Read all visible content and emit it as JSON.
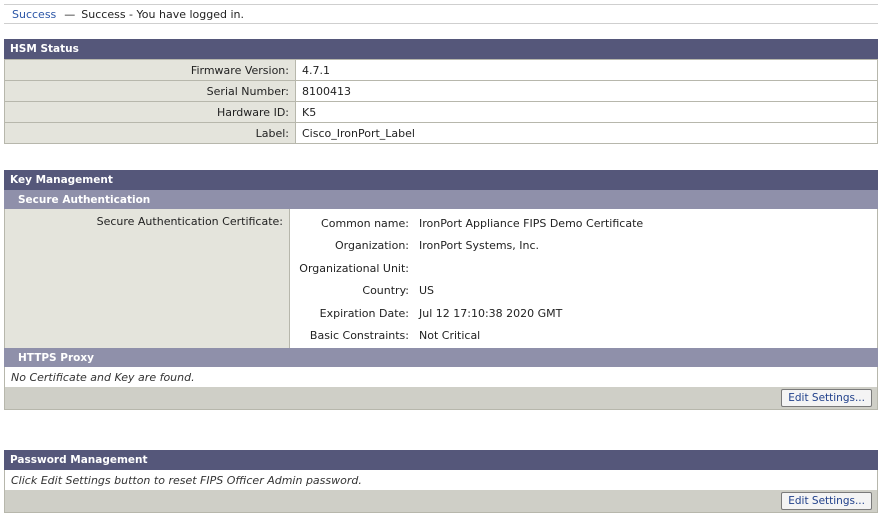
{
  "notice": {
    "type_word": "Success",
    "dash": "—",
    "message": "Success - You have logged in."
  },
  "hsm_status": {
    "title": "HSM Status",
    "rows": [
      {
        "label": "Firmware Version:",
        "value": "4.7.1"
      },
      {
        "label": "Serial Number:",
        "value": "8100413"
      },
      {
        "label": "Hardware ID:",
        "value": "K5"
      },
      {
        "label": "Label:",
        "value": "Cisco_IronPort_Label"
      }
    ]
  },
  "key_management": {
    "title": "Key Management",
    "secure_auth": {
      "title": "Secure Authentication",
      "cert_label": "Secure Authentication Certificate:",
      "fields": [
        {
          "label": "Common name:",
          "value": "IronPort Appliance FIPS Demo Certificate"
        },
        {
          "label": "Organization:",
          "value": "IronPort Systems, Inc."
        },
        {
          "label": "Organizational Unit:",
          "value": ""
        },
        {
          "label": "Country:",
          "value": "US"
        },
        {
          "label": "Expiration Date:",
          "value": "Jul 12 17:10:38 2020 GMT"
        },
        {
          "label": "Basic Constraints:",
          "value": "Not Critical"
        }
      ]
    },
    "https_proxy": {
      "title": "HTTPS Proxy",
      "message": "No Certificate and Key are found."
    },
    "edit_label": "Edit Settings..."
  },
  "password_management": {
    "title": "Password Management",
    "message": "Click Edit Settings button to reset FIPS Officer Admin password.",
    "edit_label": "Edit Settings..."
  },
  "colors": {
    "header": "#55577a",
    "subheader": "#8f90aa",
    "label_bg": "#e4e4dc",
    "link": "#2a55a6"
  }
}
